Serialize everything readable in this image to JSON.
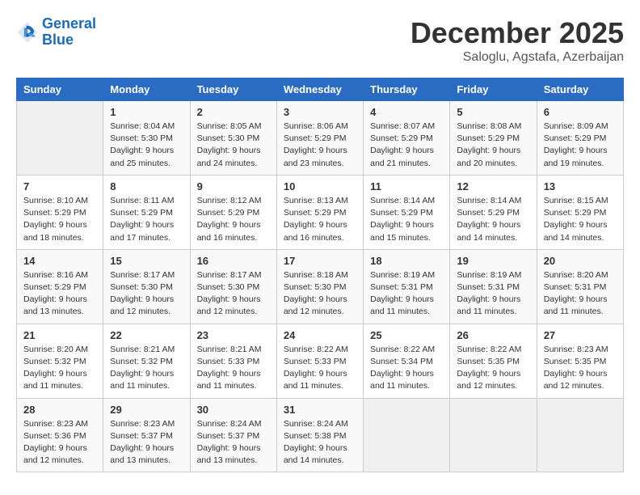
{
  "logo": {
    "line1": "General",
    "line2": "Blue"
  },
  "title": "December 2025",
  "location": "Saloglu, Agstafa, Azerbaijan",
  "days_of_week": [
    "Sunday",
    "Monday",
    "Tuesday",
    "Wednesday",
    "Thursday",
    "Friday",
    "Saturday"
  ],
  "weeks": [
    [
      {
        "day": "",
        "info": ""
      },
      {
        "day": "1",
        "info": "Sunrise: 8:04 AM\nSunset: 5:30 PM\nDaylight: 9 hours\nand 25 minutes."
      },
      {
        "day": "2",
        "info": "Sunrise: 8:05 AM\nSunset: 5:30 PM\nDaylight: 9 hours\nand 24 minutes."
      },
      {
        "day": "3",
        "info": "Sunrise: 8:06 AM\nSunset: 5:29 PM\nDaylight: 9 hours\nand 23 minutes."
      },
      {
        "day": "4",
        "info": "Sunrise: 8:07 AM\nSunset: 5:29 PM\nDaylight: 9 hours\nand 21 minutes."
      },
      {
        "day": "5",
        "info": "Sunrise: 8:08 AM\nSunset: 5:29 PM\nDaylight: 9 hours\nand 20 minutes."
      },
      {
        "day": "6",
        "info": "Sunrise: 8:09 AM\nSunset: 5:29 PM\nDaylight: 9 hours\nand 19 minutes."
      }
    ],
    [
      {
        "day": "7",
        "info": "Sunrise: 8:10 AM\nSunset: 5:29 PM\nDaylight: 9 hours\nand 18 minutes."
      },
      {
        "day": "8",
        "info": "Sunrise: 8:11 AM\nSunset: 5:29 PM\nDaylight: 9 hours\nand 17 minutes."
      },
      {
        "day": "9",
        "info": "Sunrise: 8:12 AM\nSunset: 5:29 PM\nDaylight: 9 hours\nand 16 minutes."
      },
      {
        "day": "10",
        "info": "Sunrise: 8:13 AM\nSunset: 5:29 PM\nDaylight: 9 hours\nand 16 minutes."
      },
      {
        "day": "11",
        "info": "Sunrise: 8:14 AM\nSunset: 5:29 PM\nDaylight: 9 hours\nand 15 minutes."
      },
      {
        "day": "12",
        "info": "Sunrise: 8:14 AM\nSunset: 5:29 PM\nDaylight: 9 hours\nand 14 minutes."
      },
      {
        "day": "13",
        "info": "Sunrise: 8:15 AM\nSunset: 5:29 PM\nDaylight: 9 hours\nand 14 minutes."
      }
    ],
    [
      {
        "day": "14",
        "info": "Sunrise: 8:16 AM\nSunset: 5:29 PM\nDaylight: 9 hours\nand 13 minutes."
      },
      {
        "day": "15",
        "info": "Sunrise: 8:17 AM\nSunset: 5:30 PM\nDaylight: 9 hours\nand 12 minutes."
      },
      {
        "day": "16",
        "info": "Sunrise: 8:17 AM\nSunset: 5:30 PM\nDaylight: 9 hours\nand 12 minutes."
      },
      {
        "day": "17",
        "info": "Sunrise: 8:18 AM\nSunset: 5:30 PM\nDaylight: 9 hours\nand 12 minutes."
      },
      {
        "day": "18",
        "info": "Sunrise: 8:19 AM\nSunset: 5:31 PM\nDaylight: 9 hours\nand 11 minutes."
      },
      {
        "day": "19",
        "info": "Sunrise: 8:19 AM\nSunset: 5:31 PM\nDaylight: 9 hours\nand 11 minutes."
      },
      {
        "day": "20",
        "info": "Sunrise: 8:20 AM\nSunset: 5:31 PM\nDaylight: 9 hours\nand 11 minutes."
      }
    ],
    [
      {
        "day": "21",
        "info": "Sunrise: 8:20 AM\nSunset: 5:32 PM\nDaylight: 9 hours\nand 11 minutes."
      },
      {
        "day": "22",
        "info": "Sunrise: 8:21 AM\nSunset: 5:32 PM\nDaylight: 9 hours\nand 11 minutes."
      },
      {
        "day": "23",
        "info": "Sunrise: 8:21 AM\nSunset: 5:33 PM\nDaylight: 9 hours\nand 11 minutes."
      },
      {
        "day": "24",
        "info": "Sunrise: 8:22 AM\nSunset: 5:33 PM\nDaylight: 9 hours\nand 11 minutes."
      },
      {
        "day": "25",
        "info": "Sunrise: 8:22 AM\nSunset: 5:34 PM\nDaylight: 9 hours\nand 11 minutes."
      },
      {
        "day": "26",
        "info": "Sunrise: 8:22 AM\nSunset: 5:35 PM\nDaylight: 9 hours\nand 12 minutes."
      },
      {
        "day": "27",
        "info": "Sunrise: 8:23 AM\nSunset: 5:35 PM\nDaylight: 9 hours\nand 12 minutes."
      }
    ],
    [
      {
        "day": "28",
        "info": "Sunrise: 8:23 AM\nSunset: 5:36 PM\nDaylight: 9 hours\nand 12 minutes."
      },
      {
        "day": "29",
        "info": "Sunrise: 8:23 AM\nSunset: 5:37 PM\nDaylight: 9 hours\nand 13 minutes."
      },
      {
        "day": "30",
        "info": "Sunrise: 8:24 AM\nSunset: 5:37 PM\nDaylight: 9 hours\nand 13 minutes."
      },
      {
        "day": "31",
        "info": "Sunrise: 8:24 AM\nSunset: 5:38 PM\nDaylight: 9 hours\nand 14 minutes."
      },
      {
        "day": "",
        "info": ""
      },
      {
        "day": "",
        "info": ""
      },
      {
        "day": "",
        "info": ""
      }
    ]
  ]
}
